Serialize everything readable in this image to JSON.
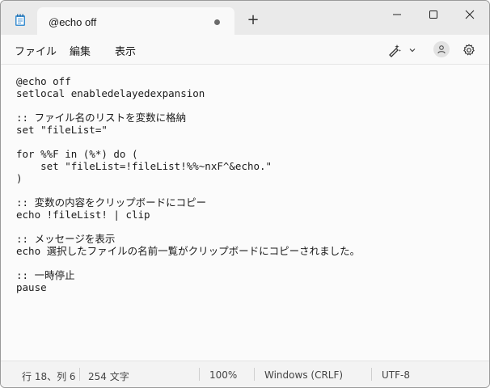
{
  "titlebar": {
    "app_icon": "notepad-icon",
    "tab_title": "@echo off",
    "tab_unsaved_indicator": "dot",
    "new_tab_label": "+",
    "buttons": [
      "minimize-icon",
      "maximize-icon",
      "close-icon"
    ]
  },
  "menu": {
    "file": "ファイル",
    "edit": "編集",
    "view": "表示"
  },
  "toolbar": {
    "icons": [
      "copilot-icon",
      "chevron-down-icon",
      "account-icon",
      "gear-icon"
    ]
  },
  "editor": {
    "lines": [
      "@echo off",
      "setlocal enabledelayedexpansion",
      "",
      ":: ファイル名のリストを変数に格納",
      "set \"fileList=\"",
      "",
      "for %%F in (%*) do (",
      "    set \"fileList=!fileList!%%~nxF^&echo.\"",
      ")",
      "",
      ":: 変数の内容をクリップボードにコピー",
      "echo !fileList! | clip",
      "",
      ":: メッセージを表示",
      "echo 選択したファイルの名前一覧がクリップボードにコピーされました。",
      "",
      ":: 一時停止",
      "pause"
    ]
  },
  "status": {
    "position": "行 18、列 6",
    "chars": "254 文字",
    "zoom": "100%",
    "line_ending": "Windows (CRLF)",
    "encoding": "UTF-8"
  }
}
